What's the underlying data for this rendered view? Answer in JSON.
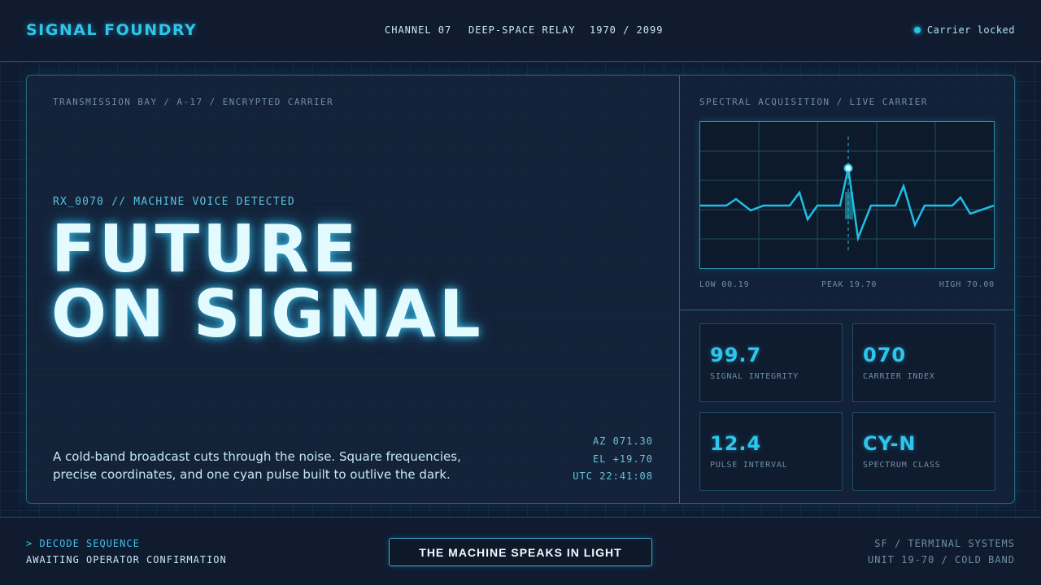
{
  "header": {
    "brand": "SIGNAL FOUNDRY",
    "nav": [
      "CHANNEL 07",
      "DEEP-SPACE RELAY",
      "1970 / 2099"
    ],
    "status": "Carrier locked",
    "status_color": "#26c3ea"
  },
  "main": {
    "breadcrumb": "TRANSMISSION BAY / A-17 / ENCRYPTED CARRIER",
    "rx_label": "RX_0070 // MACHINE VOICE DETECTED",
    "headline_line1": "FUTURE",
    "headline_line2": "ON SIGNAL",
    "blurb_line1": "A cold-band broadcast cuts through the noise. Square frequencies,",
    "blurb_line2": "precise coordinates, and one cyan pulse built to outlive the dark.",
    "coords": {
      "az": "AZ 071.30",
      "el": "EL +19.70",
      "utc": "UTC 22:41:08"
    }
  },
  "spectral": {
    "title": "SPECTRAL ACQUISITION / LIVE CARRIER",
    "low_label": "LOW 00.19",
    "peak_label": "PEAK 19.70",
    "high_label": "HIGH 70.00",
    "line_color": "#1fbfe6"
  },
  "stats": [
    {
      "value": "99.7",
      "label": "SIGNAL INTEGRITY"
    },
    {
      "value": "070",
      "label": "CARRIER INDEX"
    },
    {
      "value": "12.4",
      "label": "PULSE INTERVAL"
    },
    {
      "value": "CY-N",
      "label": "SPECTRUM CLASS"
    }
  ],
  "footer": {
    "command": "> DECODE SEQUENCE",
    "awaiting": "AWAITING OPERATOR CONFIRMATION",
    "cta": "THE MACHINE SPEAKS IN LIGHT",
    "right_line1": "SF / TERMINAL SYSTEMS",
    "right_line2": "UNIT 19-70 / COLD BAND"
  }
}
